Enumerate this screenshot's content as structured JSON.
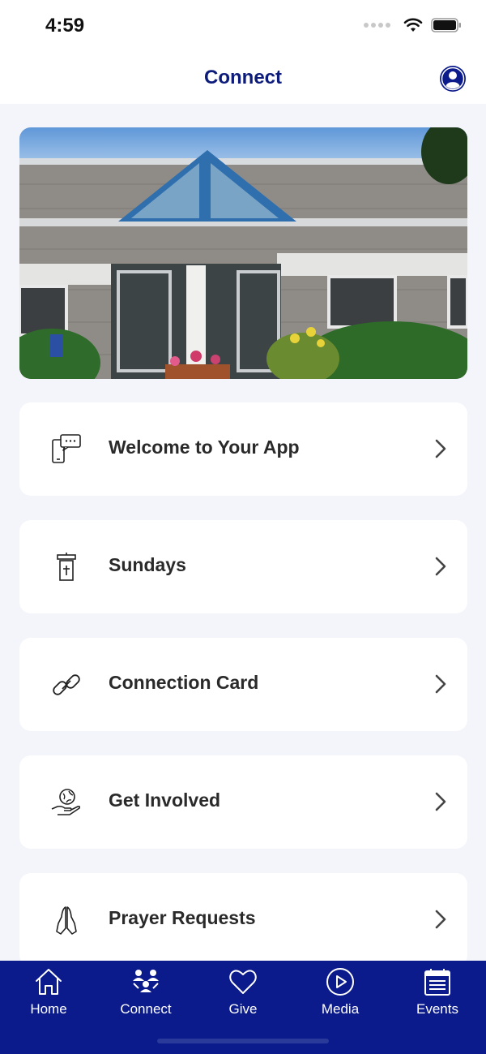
{
  "status_bar": {
    "time": "4:59"
  },
  "header": {
    "title": "Connect",
    "profile_icon": "person-circle-icon"
  },
  "hero": {
    "description_icon": "church-building-photo"
  },
  "menu": [
    {
      "label": "Welcome to Your App",
      "icon": "phone-chat-icon"
    },
    {
      "label": "Sundays",
      "icon": "pulpit-icon"
    },
    {
      "label": "Connection Card",
      "icon": "link-icon"
    },
    {
      "label": "Get Involved",
      "icon": "hand-globe-icon"
    },
    {
      "label": "Prayer Requests",
      "icon": "praying-hands-icon"
    }
  ],
  "tabbar": [
    {
      "label": "Home",
      "icon": "house-icon"
    },
    {
      "label": "Connect",
      "icon": "people-icon"
    },
    {
      "label": "Give",
      "icon": "heart-icon"
    },
    {
      "label": "Media",
      "icon": "play-circle-icon"
    },
    {
      "label": "Events",
      "icon": "calendar-icon"
    }
  ],
  "colors": {
    "brand": "#0b1b8c",
    "title": "#0d1c7a",
    "background": "#f3f5fa",
    "card": "#ffffff"
  }
}
